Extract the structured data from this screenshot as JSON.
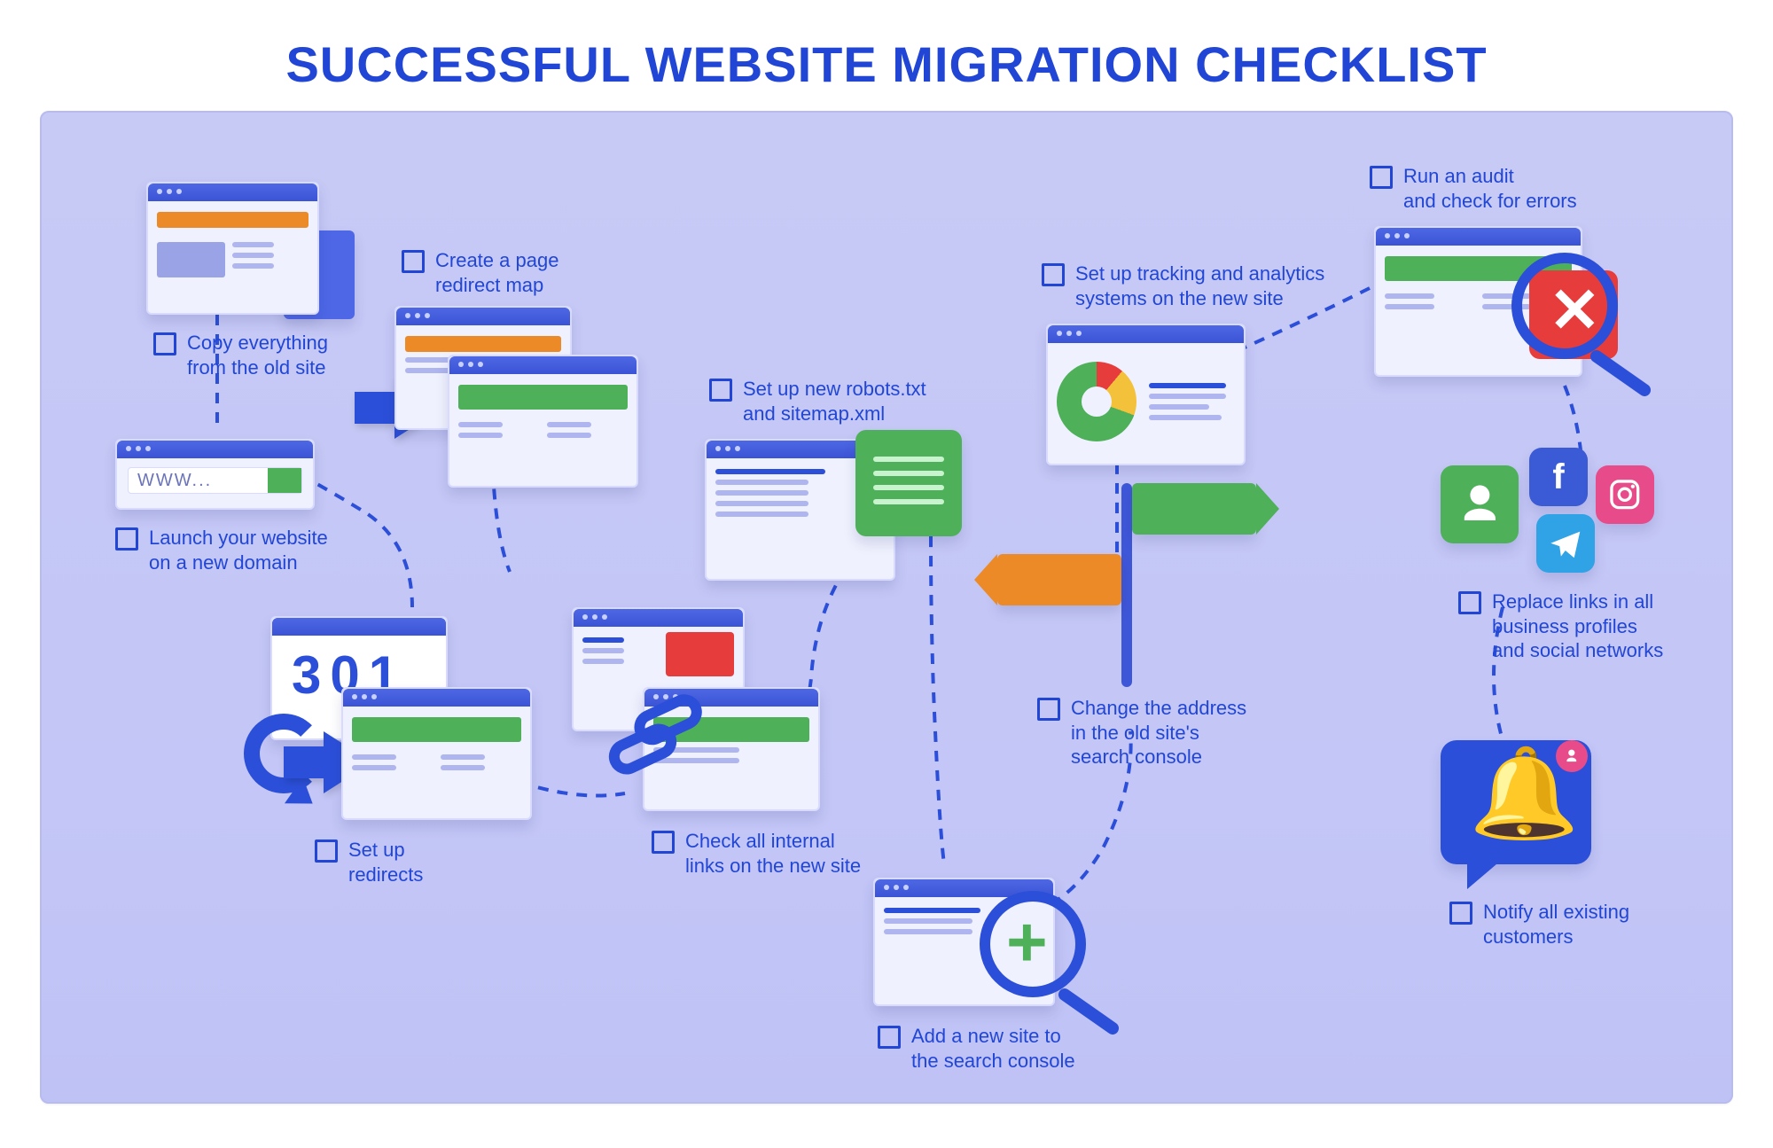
{
  "title": "SUCCESSFUL WEBSITE MIGRATION CHECKLIST",
  "steps": {
    "s1": "Copy everything\nfrom the old site",
    "s2": "Launch your website\non a new domain",
    "s3": "Create a page\nredirect map",
    "s4": "Set up\nredirects",
    "s5": "Check all internal\nlinks on the new site",
    "s6": "Set up new robots.txt\nand sitemap.xml",
    "s7": "Add a new site to\nthe search console",
    "s8": "Change the address\nin the old site's\nsearch console",
    "s9": "Set up tracking and analytics\nsystems on the new site",
    "s10": "Run an audit\nand check for errors",
    "s11": "Replace links in all\nbusiness profiles\nand social networks",
    "s12": "Notify all existing\ncustomers"
  },
  "url_placeholder": "WWW...",
  "redirect_code": "301",
  "icons": {
    "person": "person-icon",
    "facebook": "facebook-icon",
    "instagram": "instagram-icon",
    "telegram": "telegram-icon",
    "bell": "bell-icon",
    "magnifier_plus": "magnifier-plus-icon",
    "magnifier_x": "magnifier-x-icon",
    "signpost": "signpost-icon",
    "pie": "pie-chart-icon",
    "chain": "chain-link-icon",
    "arrow": "arrow-icon"
  },
  "colors": {
    "accent_blue": "#2b4fd8",
    "orange": "#eb8a27",
    "green": "#4fb05a",
    "red": "#e73c3c",
    "yellow": "#f4c13a",
    "background_lavender": "#c7caf5"
  }
}
